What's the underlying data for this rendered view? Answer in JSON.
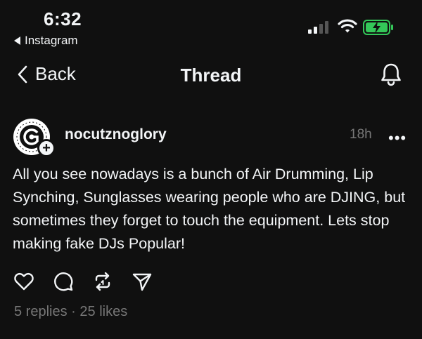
{
  "status_bar": {
    "time": "6:32",
    "back_app": "Instagram",
    "signal_icon": "cellular-signal-icon",
    "wifi_icon": "wifi-icon",
    "battery_icon": "battery-charging-icon",
    "battery_color": "#34c759"
  },
  "nav": {
    "back_label": "Back",
    "title": "Thread",
    "notifications_icon": "bell-icon"
  },
  "post": {
    "username": "nocutznoglory",
    "time_ago": "18h",
    "more_label": "•••",
    "follow_label": "+",
    "text": "All you see nowadays is a bunch of Air Drumming, Lip Synching, Sunglasses wearing people who are DJING, but sometimes they forget to touch the equipment. Lets stop making fake DJs Popular!",
    "actions": [
      "heart-icon",
      "comment-icon",
      "repost-icon",
      "send-icon"
    ],
    "replies": "5 replies",
    "separator": "·",
    "likes": "25 likes"
  },
  "colors": {
    "background": "#101010",
    "text": "#f3f5f7",
    "muted": "#777777"
  }
}
